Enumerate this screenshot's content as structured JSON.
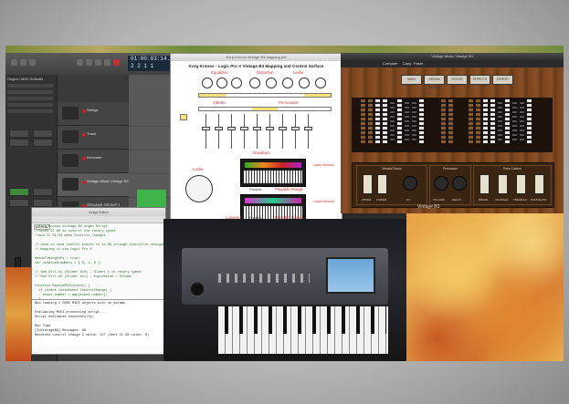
{
  "logic": {
    "lcd_lines": [
      "01:00:03:14.53",
      "2  2  1  1"
    ],
    "inspector_title": "Region: MIDI Defaults",
    "tracks": [
      {
        "name": "Strings"
      },
      {
        "name": "Track"
      },
      {
        "name": "Drummer"
      },
      {
        "name": "Vintage Music Vintage B3"
      },
      {
        "name": "ORGANS GROUP 1"
      }
    ],
    "inspector_buttons": [
      "Setting",
      "EQ",
      "Input",
      "Output"
    ]
  },
  "script_editor": {
    "title": "Script Editor",
    "run_button": "Run Script",
    "code_lines": [
      "//Korg Kronos Vintage B3 organ Script",
      "//Sends CC 80 to control the rotary speed",
      "//and CC 31/33 when Controls Changes",
      "",
      "// Used to send control events to to B3 through Controller Assignments",
      "// mapping it via Logic Pro X",
      "",
      "NeedsTimingInfo = true;",
      "var ccValueDrawBars = [ 0, 1, 0 ];",
      "",
      "// Cmd Ctrl #1 (Slider #10) - Slider 1 to rotary speed",
      "// Cmd Ctrl #2 (Slider #11) - Expression / Volume",
      "",
      "function HandleMIDI(event) {",
      "  if (event instanceof ControlChange) {",
      "    event.number = map[event.number];",
      "  }",
      "  event.send();",
      "}"
    ],
    "console_lines": [
      "Now loading 1 CORE MIDI objects with no params",
      "",
      "Evaluating MIDI-processing script...",
      "Script evaluated successfully!",
      "",
      "Run Time",
      "[ToVintageB3] Messages: 96",
      "Received control change 2 value: 127 (Sent CC 80 value: 0)"
    ]
  },
  "pdf": {
    "window_title": "Korg Kronos Vintage B3 mapping.pdf",
    "heading": "Korg Kronos - Logic Pro X Vintage B3 Mapping and Control Surface",
    "labels": {
      "equalizer": "Equalizer",
      "distortion": "Distortion",
      "leslie": "Leslie",
      "vibrato": "Vibrato",
      "percussion": "Percussion",
      "drawbars": "Drawbars",
      "leslie2": "Leslie",
      "upper_manual": "Upper Manual",
      "lower_manual": "Lower Manual",
      "presets1": "Presets",
      "playable1": "Playable Range",
      "presets2": "Presets",
      "playable2": "Playable Range",
      "lowered": "Lowered"
    }
  },
  "vintage_b3": {
    "window_title": "Vintage Music Vintage B3",
    "tabs": [
      "Compare",
      "Copy",
      "Paste"
    ],
    "header_buttons": [
      "MAIN",
      "ORGAN SOUND",
      "ROTOR",
      "EFFECTS",
      "EXPERT"
    ],
    "groups": [
      {
        "label": "Vibrato/Chorus",
        "toggles": [
          "UPPER",
          "LOWER"
        ],
        "knob": "C3"
      },
      {
        "label": "Percussion",
        "knobs": [
          "VOLUME",
          "DECAY"
        ]
      },
      {
        "label": "Rotor Cabinet",
        "toggles": [
          "BRAKE",
          "CHORALE",
          "TREMOLO",
          "FAST/SLOW"
        ]
      }
    ],
    "footer": "Vintage B3"
  }
}
